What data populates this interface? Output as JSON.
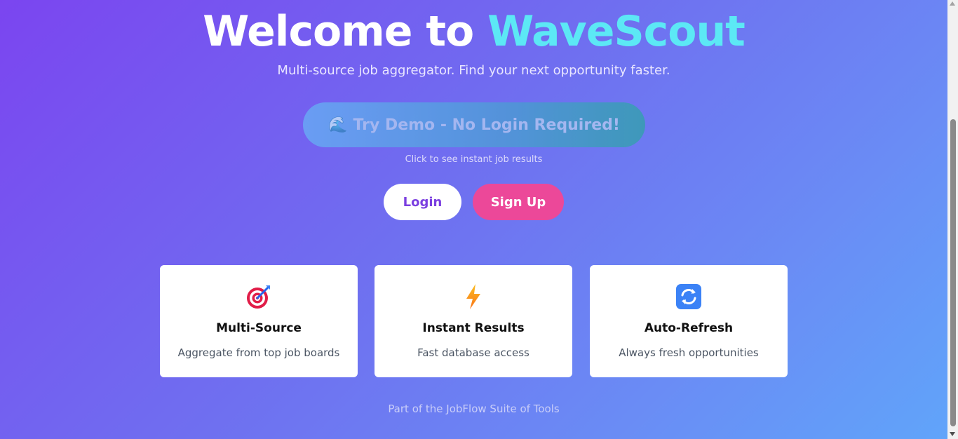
{
  "hero": {
    "title_prefix": "Welcome to ",
    "title_brand": "WaveScout",
    "subtitle": "Multi-source job aggregator. Find your next opportunity faster."
  },
  "demo": {
    "icon": "wave-icon",
    "label": "Try Demo - No Login Required!",
    "hint": "Click to see instant job results"
  },
  "auth": {
    "login_label": "Login",
    "signup_label": "Sign Up"
  },
  "features": [
    {
      "icon": "target-icon",
      "title": "Multi-Source",
      "description": "Aggregate from top job boards"
    },
    {
      "icon": "lightning-icon",
      "title": "Instant Results",
      "description": "Fast database access"
    },
    {
      "icon": "refresh-icon",
      "title": "Auto-Refresh",
      "description": "Always fresh opportunities"
    }
  ],
  "footer": {
    "text": "Part of the JobFlow Suite of Tools"
  },
  "colors": {
    "brand": "#5ce8f5",
    "signup": "#ec4899",
    "login_text": "#7b3fe0"
  }
}
